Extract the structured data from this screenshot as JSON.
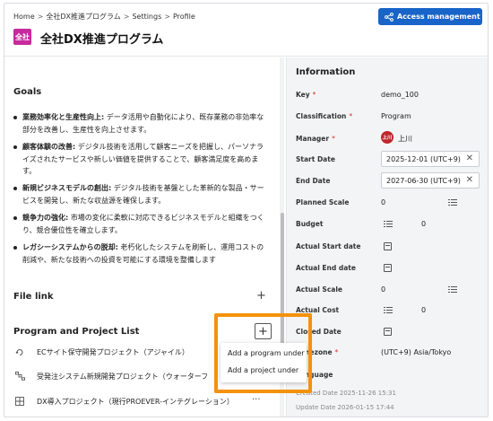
{
  "breadcrumb": {
    "items": [
      "Home",
      "全社DX推進プログラム",
      "Settings",
      "Profile"
    ]
  },
  "header": {
    "badge": "全社",
    "title": "全社DX推進プログラム",
    "access_button": "Access management"
  },
  "goals": {
    "title": "Goals",
    "items": [
      {
        "head": "業務効率化と生産性向上:",
        "text": " データ活用や自動化により、既存業務の非効率な部分を改善し、生産性を向上させます。"
      },
      {
        "head": "顧客体験の改善:",
        "text": " デジタル技術を活用して顧客ニーズを把握し、パーソナライズされたサービスや新しい価値を提供することで、顧客満足度を高めます。"
      },
      {
        "head": "新規ビジネスモデルの創出:",
        "text": " デジタル技術を基盤とした革新的な製品・サービスを開発し、新たな収益源を確保します。"
      },
      {
        "head": "競争力の強化:",
        "text": " 市場の変化に柔軟に対応できるビジネスモデルと組織をつくり、競合優位性を確立します。"
      },
      {
        "head": "レガシーシステムからの脱却:",
        "text": " 老朽化したシステムを刷新し、運用コストの削減や、新たな技術への投資を可能にする環境を整備します"
      }
    ]
  },
  "file_link": {
    "title": "File link"
  },
  "program_list": {
    "title": "Program and Project List",
    "items": [
      {
        "label": "ECサイト保守開発プロジェクト（アジャイル）",
        "icon": "agile-cycle-icon"
      },
      {
        "label": "受発注システム新規開発プロジェクト（ウォーターフ",
        "icon": "waterfall-icon"
      },
      {
        "label": "DX導入プロジェクト（現行PROEVER-インテグレーション）",
        "icon": "grid-icon",
        "more": "···"
      }
    ],
    "menu": [
      "Add a program under",
      "Add a project under"
    ]
  },
  "information": {
    "title": "Information",
    "key": {
      "label": "Key",
      "value": "demo_100"
    },
    "classification": {
      "label": "Classification",
      "value": "Program"
    },
    "manager": {
      "label": "Manager",
      "avatar": "上川",
      "value": "上川"
    },
    "start_date": {
      "label": "Start Date",
      "value": "2025-12-01 (UTC+9)"
    },
    "end_date": {
      "label": "End Date",
      "value": "2027-06-30 (UTC+9)"
    },
    "planned_scale": {
      "label": "Planned Scale",
      "value": "0"
    },
    "budget": {
      "label": "Budget",
      "value": "0"
    },
    "actual_start": {
      "label": "Actual Start date"
    },
    "actual_end": {
      "label": "Actual End date"
    },
    "actual_scale": {
      "label": "Actual Scale",
      "value": "0"
    },
    "actual_cost": {
      "label": "Actual Cost",
      "value": "0"
    },
    "closed_date": {
      "label": "Closed Date"
    },
    "timezone": {
      "label": "Timezone",
      "value": "(UTC+9) Asia/Tokyo"
    },
    "language": {
      "label": "Language"
    },
    "created": "Created Date 2025-11-26 15:31",
    "updated": "Update Date 2026-01-15 17:44"
  },
  "colors": {
    "accent": "#1864c8",
    "highlight": "#f4920b",
    "badge": "#c62a9c",
    "required": "#d32f2f"
  }
}
